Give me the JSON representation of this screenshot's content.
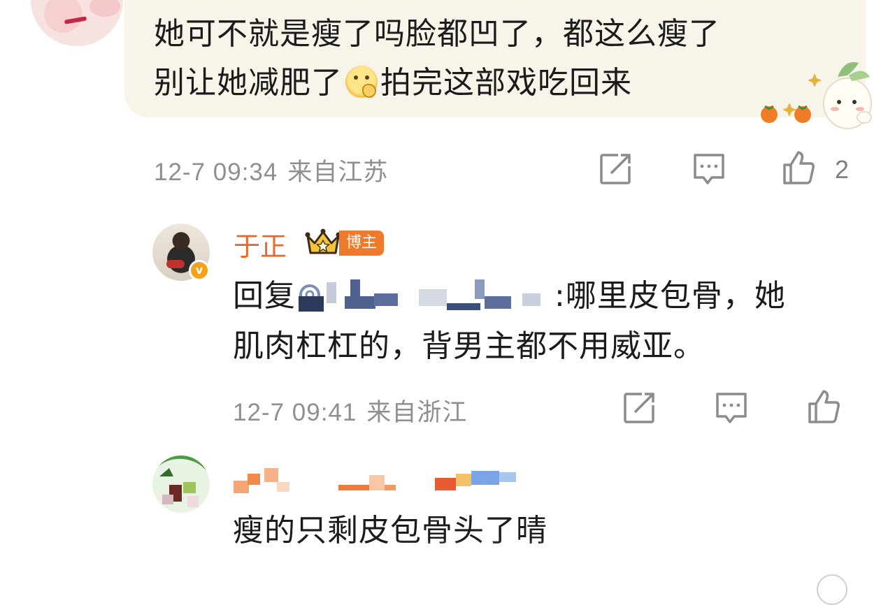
{
  "comment1": {
    "text_line1": "她可不就是瘦了吗脸都凹了，都这么瘦了",
    "text_line2_before": "别让她减肥了",
    "emoji": "thinking-face-emoji",
    "text_line2_after": "拍完这部戏吃回来",
    "time": "12-7 09:34",
    "location": "来自江苏",
    "like_count": "2",
    "sticker": "radish-mascot-with-persimmons-sticker",
    "background_color": "#f8f4ea"
  },
  "reply": {
    "author": "于正",
    "tag": "博主",
    "prefix": "回复",
    "mention_redacted": true,
    "text_after_mention": ":哪里皮包骨，她",
    "text_line2": "肌肉杠杠的，背男主都不用威亚。",
    "time": "12-7 09:41",
    "location": "来自浙江",
    "name_color": "#e8682f",
    "badge_color": "#f5a21a"
  },
  "comment3": {
    "author_redacted": true,
    "text": "瘦的只剩皮包骨头了晴"
  },
  "icons": {
    "repost": "repost-icon",
    "comment": "comment-icon",
    "like": "thumbs-up-icon",
    "crown": "crown-icon",
    "verified": "verified-badge-icon"
  }
}
